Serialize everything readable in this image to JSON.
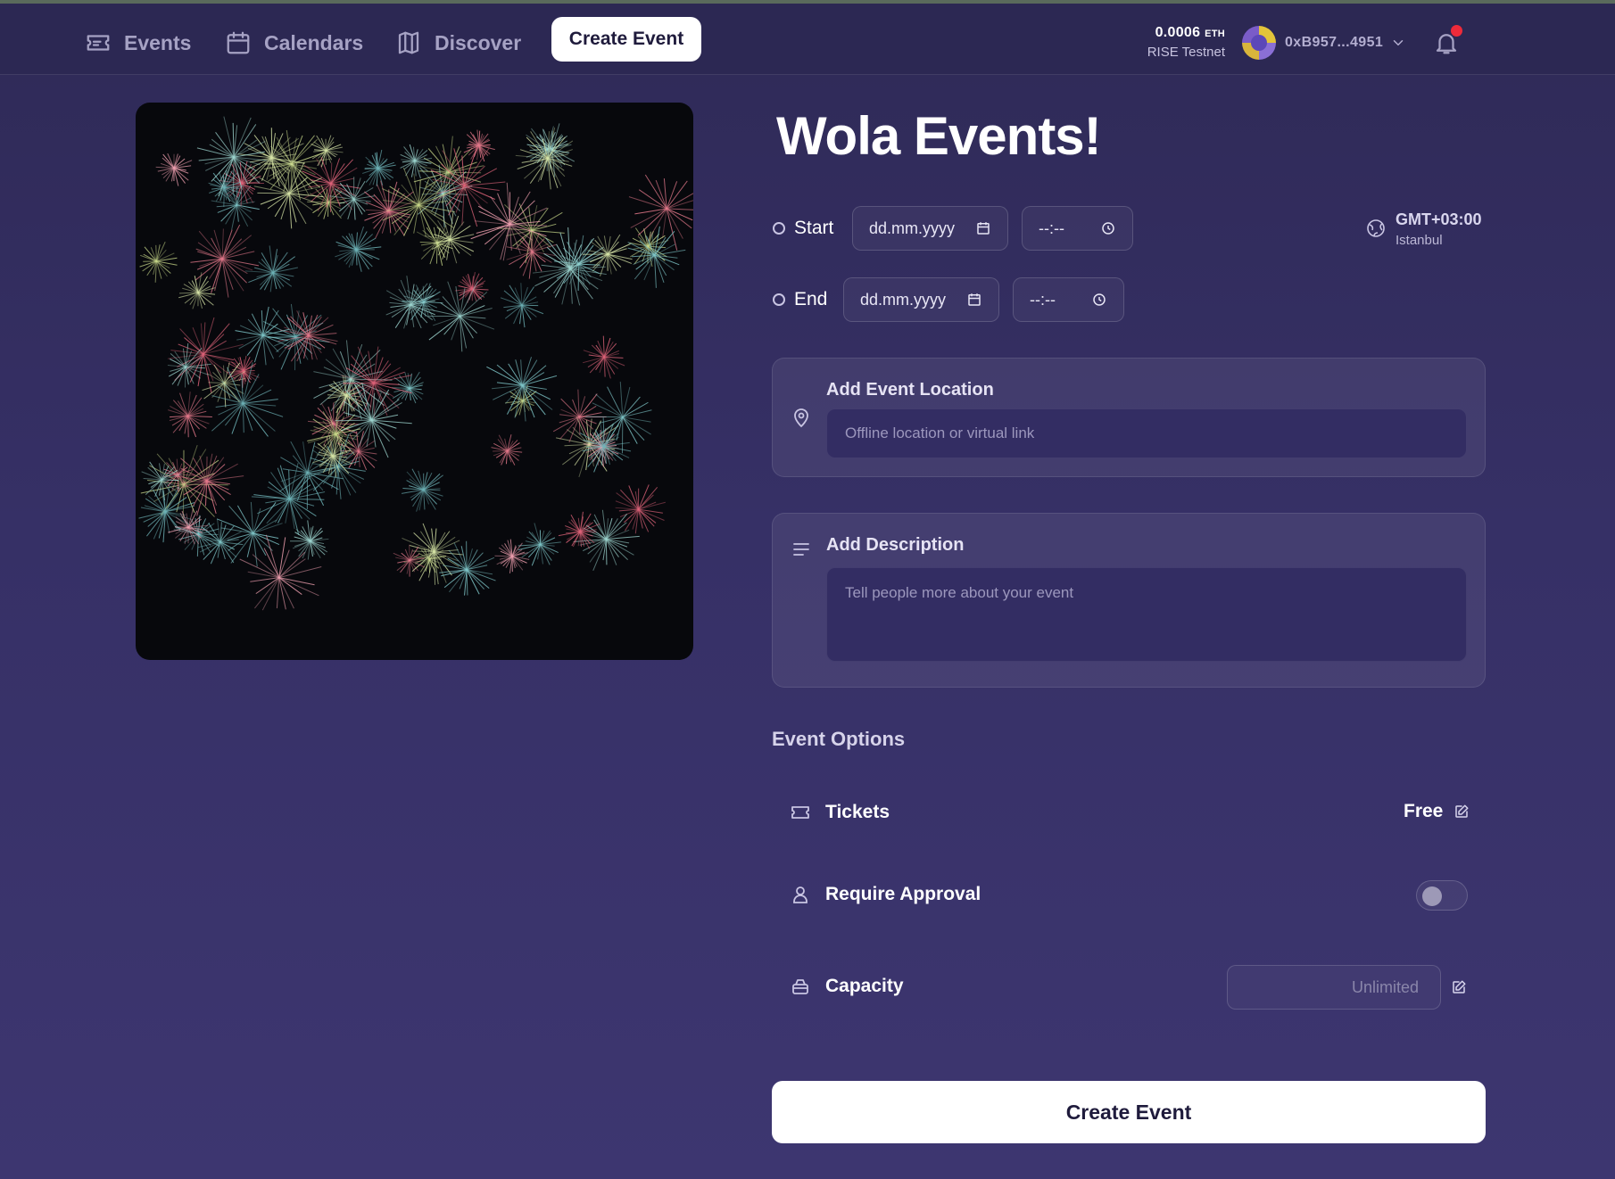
{
  "nav": {
    "items": [
      {
        "label": "Events",
        "icon": "ticket-icon"
      },
      {
        "label": "Calendars",
        "icon": "calendar-icon"
      },
      {
        "label": "Discover",
        "icon": "map-icon"
      }
    ],
    "create_label": "Create Event",
    "balance_amount": "0.0006",
    "balance_unit": "ETH",
    "network": "RISE Testnet",
    "wallet_address": "0xB957...4951"
  },
  "event": {
    "title": "Wola Events!",
    "start_label": "Start",
    "end_label": "End",
    "date_placeholder": "dd.mm.yyyy",
    "time_placeholder": "--:--",
    "timezone": "GMT+03:00",
    "timezone_city": "Istanbul"
  },
  "location": {
    "label": "Add Event Location",
    "placeholder": "Offline location or virtual link"
  },
  "description": {
    "label": "Add Description",
    "placeholder": "Tell people more about your event"
  },
  "options": {
    "title": "Event Options",
    "tickets_label": "Tickets",
    "tickets_value": "Free",
    "approval_label": "Require Approval",
    "approval_enabled": false,
    "capacity_label": "Capacity",
    "capacity_placeholder": "Unlimited"
  },
  "submit_label": "Create Event",
  "colors": {
    "background": "#332d63",
    "accent": "#ffffff",
    "notification": "#ee2a3a"
  }
}
